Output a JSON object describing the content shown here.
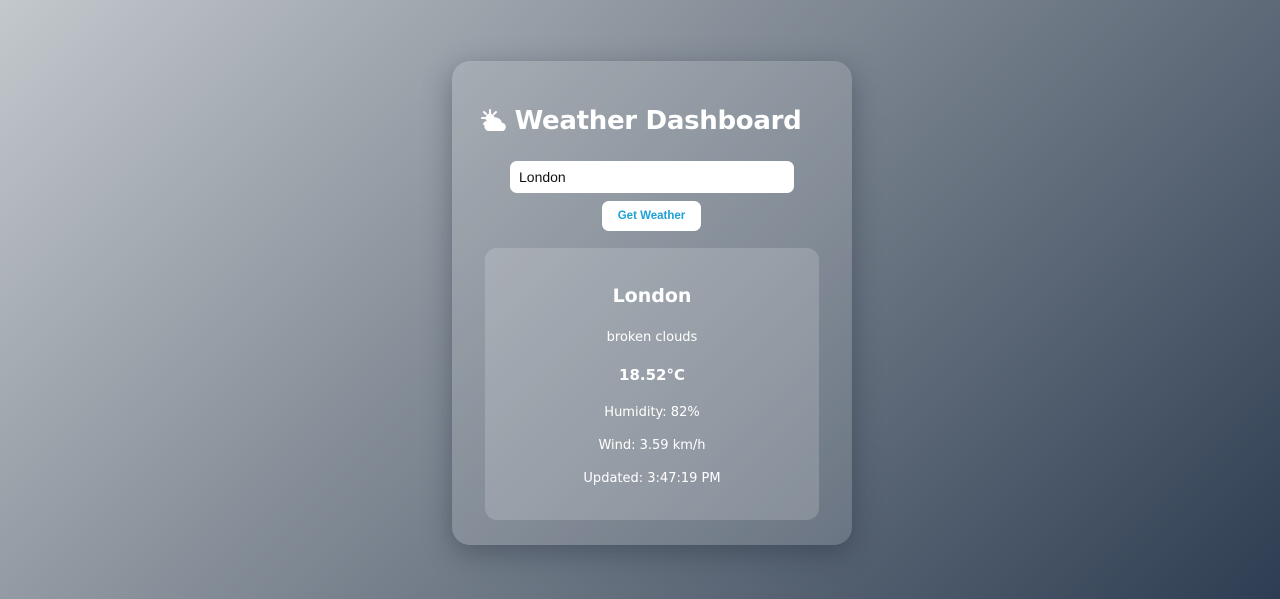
{
  "header": {
    "icon": "sun-behind-cloud-icon",
    "title": "Weather Dashboard"
  },
  "search": {
    "value": "London",
    "button_label": "Get Weather"
  },
  "weather": {
    "city": "London",
    "description": "broken clouds",
    "temperature": "18.52°C",
    "humidity": "Humidity: 82%",
    "wind": "Wind: 3.59 km/h",
    "updated": "Updated: 3:47:19 PM"
  },
  "colors": {
    "button_text": "#1da1d6",
    "text": "#ffffff"
  }
}
